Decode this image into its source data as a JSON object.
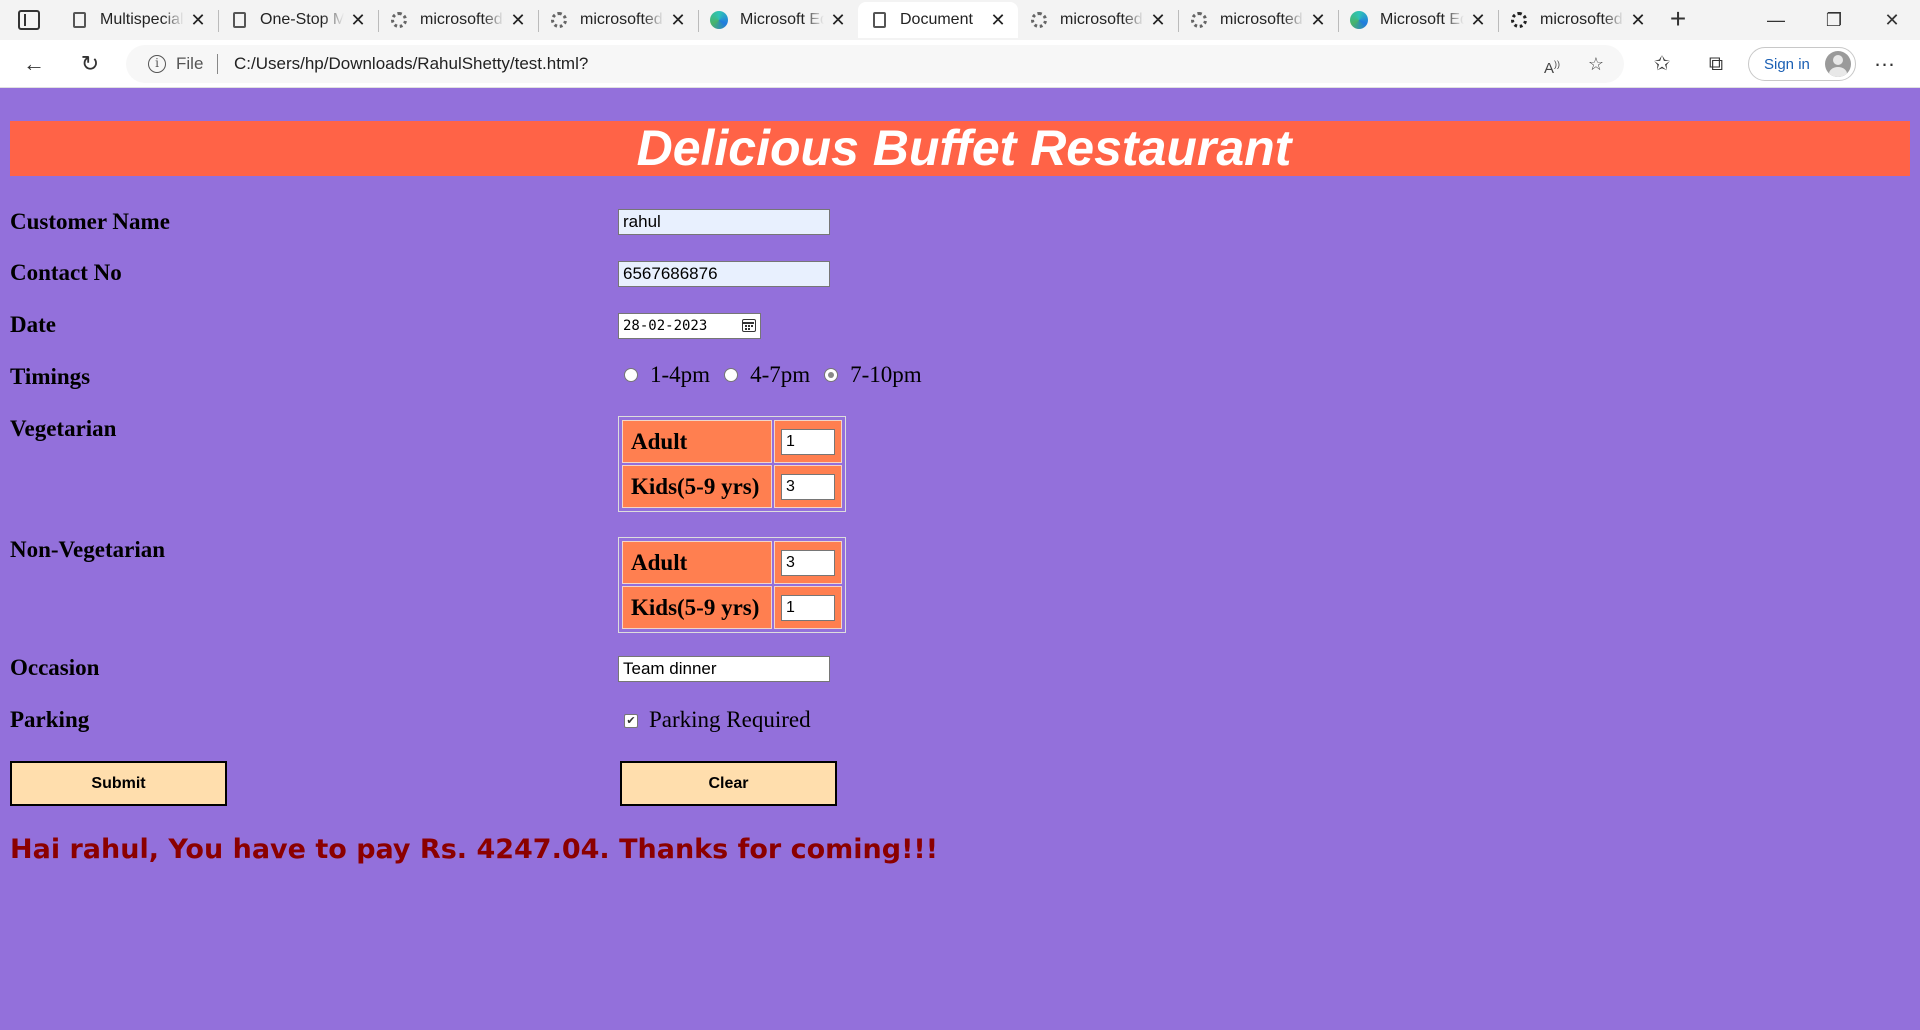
{
  "browser": {
    "tabs": [
      {
        "title": "Multispecialty",
        "icon": "document-icon",
        "active": false
      },
      {
        "title": "One-Stop Mobile",
        "icon": "document-icon",
        "active": false
      },
      {
        "title": "microsoftedge",
        "icon": "gear-icon",
        "active": false
      },
      {
        "title": "microsoftedge",
        "icon": "gear-icon",
        "active": false
      },
      {
        "title": "Microsoft Edge",
        "icon": "edge-icon",
        "active": false
      },
      {
        "title": "Document",
        "icon": "document-icon",
        "active": true
      },
      {
        "title": "microsoftedge",
        "icon": "gear-icon",
        "active": false
      },
      {
        "title": "microsoftedge",
        "icon": "gear-icon",
        "active": false
      },
      {
        "title": "Microsoft Edge",
        "icon": "edge-icon",
        "active": false
      },
      {
        "title": "microsoftedge",
        "icon": "gear-icon",
        "active": false
      }
    ],
    "address": {
      "scheme_label": "File",
      "url": "C:/Users/hp/Downloads/RahulShetty/test.html?"
    },
    "signin_label": "Sign in"
  },
  "form": {
    "title": "Delicious Buffet Restaurant",
    "customer_name": {
      "label": "Customer Name",
      "value": "rahul"
    },
    "contact": {
      "label": "Contact No",
      "value": "6567686876"
    },
    "date": {
      "label": "Date",
      "value": "28-02-2023"
    },
    "timings": {
      "label": "Timings",
      "options": [
        "1-4pm",
        "4-7pm",
        "7-10pm"
      ],
      "selected": "7-10pm"
    },
    "vegetarian": {
      "label": "Vegetarian",
      "rows": [
        {
          "label": "Adult",
          "value": "1"
        },
        {
          "label": "Kids(5-9 yrs)",
          "value": "3"
        }
      ]
    },
    "non_vegetarian": {
      "label": "Non-Vegetarian",
      "rows": [
        {
          "label": "Adult",
          "value": "3"
        },
        {
          "label": "Kids(5-9 yrs)",
          "value": "1"
        }
      ]
    },
    "occasion": {
      "label": "Occasion",
      "value": "Team dinner"
    },
    "parking": {
      "label": "Parking",
      "option_label": "Parking Required",
      "checked": true
    },
    "submit_label": "Submit",
    "clear_label": "Clear",
    "result_message": "Hai rahul, You have to pay Rs. 4247.04. Thanks for coming!!!"
  },
  "colors": {
    "page_background": "#9370db",
    "banner_background": "#ff6347",
    "table_cell": "#ff7f50",
    "button_background": "#ffdead",
    "result_text": "#8b0000"
  }
}
